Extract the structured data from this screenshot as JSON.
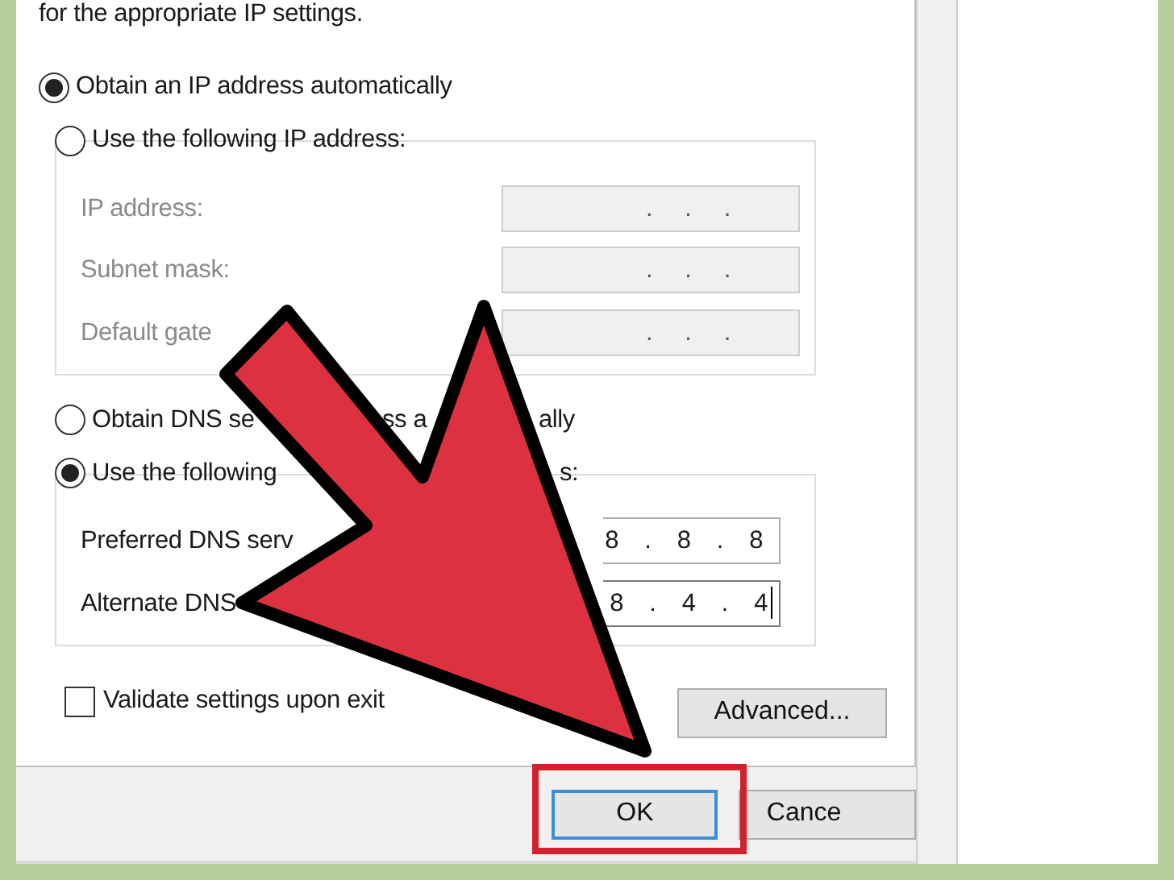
{
  "intro_text": "for the appropriate IP settings.",
  "ip_options": [
    {
      "label": "Obtain an IP address automatically",
      "selected": true
    },
    {
      "label": "Use the following IP address:",
      "selected": false
    }
  ],
  "ip_fields": [
    {
      "label": "IP address:",
      "value": ". . .",
      "disabled": true
    },
    {
      "label": "Subnet mask:",
      "value": ". . .",
      "disabled": true
    },
    {
      "label": "Default gate",
      "value": ". . .",
      "disabled": true
    }
  ],
  "dns_options": [
    {
      "parts": [
        "Obtain DNS se",
        "ss a",
        "ally"
      ],
      "selected": false
    },
    {
      "parts": [
        "Use the following",
        "s:"
      ],
      "selected": true
    }
  ],
  "dns_fields": [
    {
      "label": "Preferred DNS serv",
      "value": "8 . 8 . 8",
      "disabled": false,
      "focused": false
    },
    {
      "label": "Alternate DNS",
      "value": "8 . 4 . 4",
      "disabled": false,
      "focused": true
    }
  ],
  "validate_checkbox": {
    "label": "Validate settings upon exit",
    "checked": false
  },
  "advanced_button": "Advanced...",
  "ok_button": {
    "label": "OK",
    "focused": true,
    "highlighted": true
  },
  "cancel_button": "Cance"
}
